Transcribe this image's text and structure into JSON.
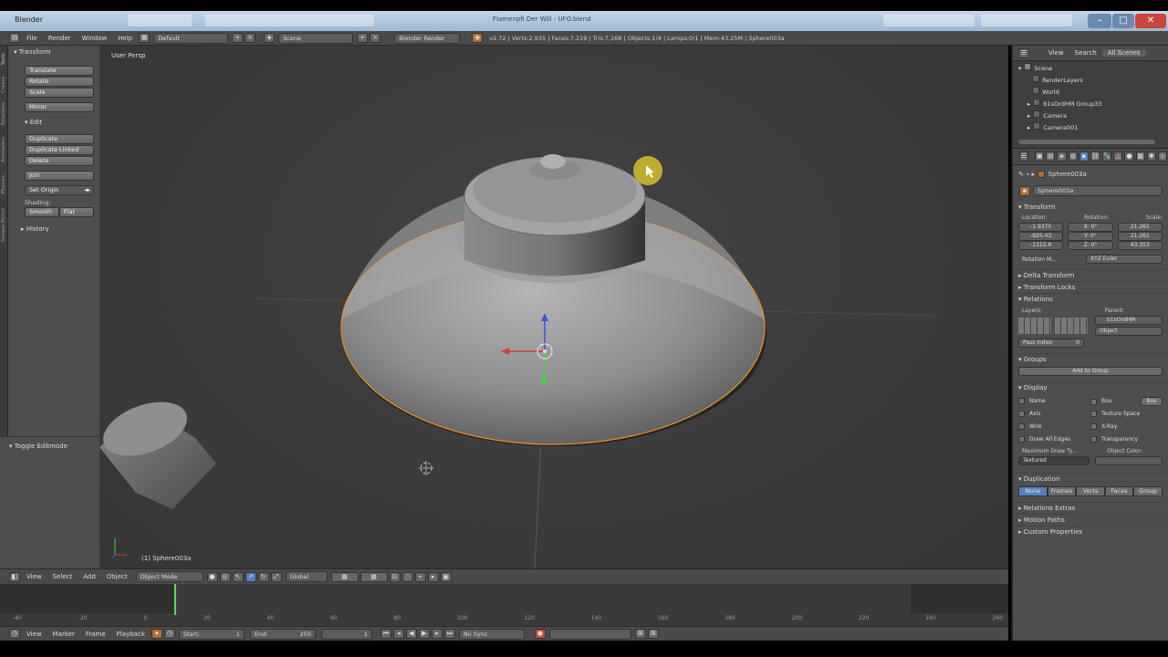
{
  "window": {
    "title": "Blender",
    "center_title": "Flamenpfi Der Wlll - UFO.blend",
    "minimize": "–",
    "maximize": "□",
    "close": "✕"
  },
  "info_header": {
    "menus": [
      "File",
      "Render",
      "Window",
      "Help"
    ],
    "layout": "Default",
    "scene": "Scene",
    "engine": "Blender Render",
    "stats": "v2.72 | Verts:2,935 | Faces:7,219 | Tris:7,168 | Objects:1/4 | Lamps:0/1 | Mem:43.25M | Sphere003a"
  },
  "tool_shelf": {
    "transform_title": "Transform",
    "transform_buttons": [
      "Translate",
      "Rotate",
      "Scale"
    ],
    "mirror": "Mirror",
    "edit_title": "Edit",
    "edit_buttons": [
      "Duplicate",
      "Duplicate Linked",
      "Delete"
    ],
    "join": "Join",
    "set_origin": "Set Origin",
    "shading_label": "Shading:",
    "smooth": "Smooth",
    "flat": "Flat",
    "history": "History",
    "toggle_editmode": "Toggle Editmode",
    "tabs": [
      "Tools",
      "Create",
      "Relations",
      "Animation",
      "Physics",
      "Grease Pencil"
    ]
  },
  "viewport": {
    "label": "User Persp",
    "object_label": "(1) Sphere003a"
  },
  "view3d_header": {
    "menus": [
      "View",
      "Select",
      "Add",
      "Object"
    ],
    "mode": "Object Mode",
    "orientation": "Global"
  },
  "timeline": {
    "ticks": [
      "-40",
      "-20",
      "0",
      "20",
      "40",
      "60",
      "80",
      "100",
      "120",
      "140",
      "160",
      "180",
      "200",
      "220",
      "240",
      "260"
    ],
    "menus": [
      "View",
      "Marker",
      "Frame",
      "Playback"
    ],
    "start_label": "Start:",
    "start_value": "1",
    "end_label": "End:",
    "end_value": "250",
    "current_frame": "1",
    "sync": "No Sync"
  },
  "outliner": {
    "tabs": [
      "View",
      "Search",
      "All Scenes"
    ],
    "items": [
      "Scene",
      "RenderLayers",
      "World",
      "b1sOrdHM Group33",
      "Camera",
      "Camera001"
    ]
  },
  "properties": {
    "object_path": "Sphere003a",
    "object_name": "Sphere003a",
    "transform_title": "Transform",
    "location_label": "Location:",
    "rotation_label": "Rotation:",
    "scale_label": "Scale:",
    "location": [
      "-1.9375",
      "-925.43",
      "-1315.8"
    ],
    "rotation": [
      "X: 0°",
      "Y: 0°",
      "Z: 0°"
    ],
    "scale": [
      "21.261",
      "21.261",
      "43.353"
    ],
    "rotation_mode_label": "Rotation M...",
    "rotation_mode": "XYZ Euler",
    "delta_transform": "Delta Transform",
    "transform_locks": "Transform Locks",
    "relations_title": "Relations",
    "layers_label": "Layers:",
    "parent_label": "Parent:",
    "parent_value": "b1sOrdHM",
    "parent_type": "Object",
    "pass_index": "Pass Index:",
    "pass_index_value": "0",
    "groups_title": "Groups",
    "add_to_group": "Add to Group",
    "display_title": "Display",
    "display_left": [
      "Name",
      "Axis",
      "Wire",
      "Draw All Edges"
    ],
    "display_right": [
      "Bou",
      "Texture Space",
      "X-Ray",
      "Transparency"
    ],
    "bounds_type": "Box",
    "max_draw_type_label": "Maximum Draw Ty...",
    "object_color_label": "Object Color:",
    "draw_type": "Textured",
    "duplication_title": "Duplication",
    "dup_options": [
      "None",
      "Frames",
      "Verts",
      "Faces",
      "Group"
    ],
    "relations_extras": "Relations Extras",
    "motion_paths": "Motion Paths",
    "custom_properties": "Custom Properties"
  },
  "colors": {
    "accent": "#5680c2",
    "selection": "#f08c1e",
    "cursor_marker": "#e8d22a",
    "frame_line": "#5fd35f"
  }
}
